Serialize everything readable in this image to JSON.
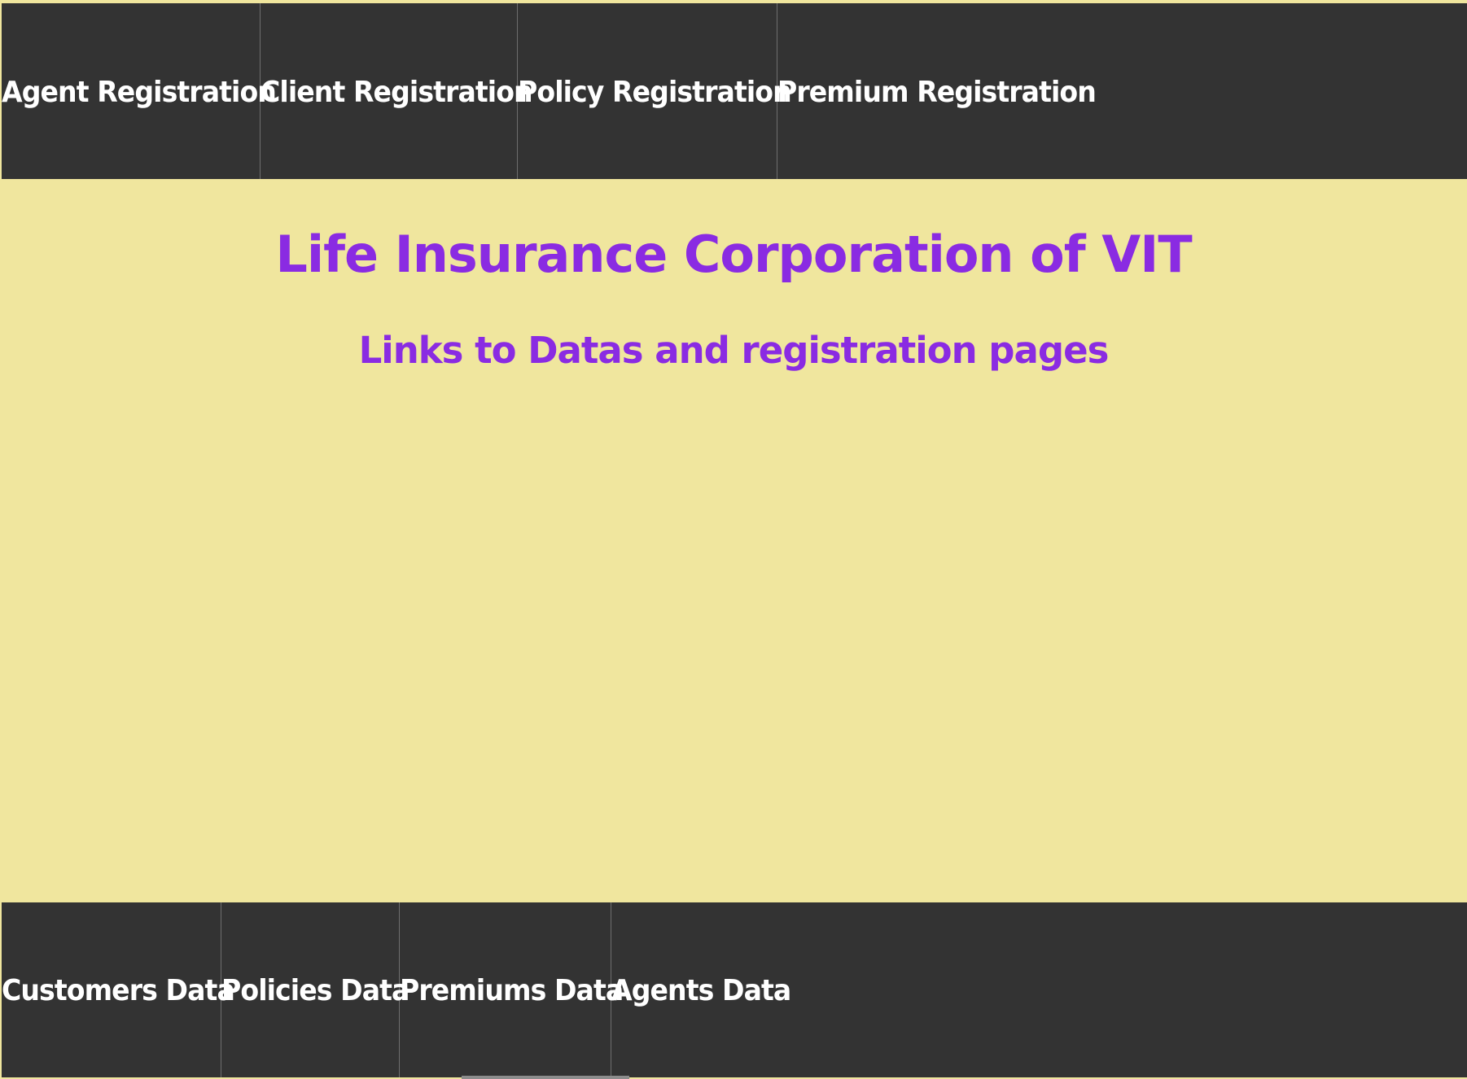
{
  "top_nav": {
    "items": [
      {
        "label": "Agent Registration"
      },
      {
        "label": "Client Registration"
      },
      {
        "label": "Policy Registration"
      },
      {
        "label": "Premium Registration"
      }
    ]
  },
  "main": {
    "title": "Life Insurance Corporation of VIT",
    "subtitle": "Links to Datas and registration pages"
  },
  "bottom_nav": {
    "items": [
      {
        "label": "Customers Data"
      },
      {
        "label": "Policies Data"
      },
      {
        "label": "Premiums Data"
      },
      {
        "label": "Agents Data"
      }
    ]
  },
  "colors": {
    "background": "#f0e69e",
    "navbar": "#333333",
    "heading": "#8a2be2",
    "nav_text": "#ffffff"
  }
}
